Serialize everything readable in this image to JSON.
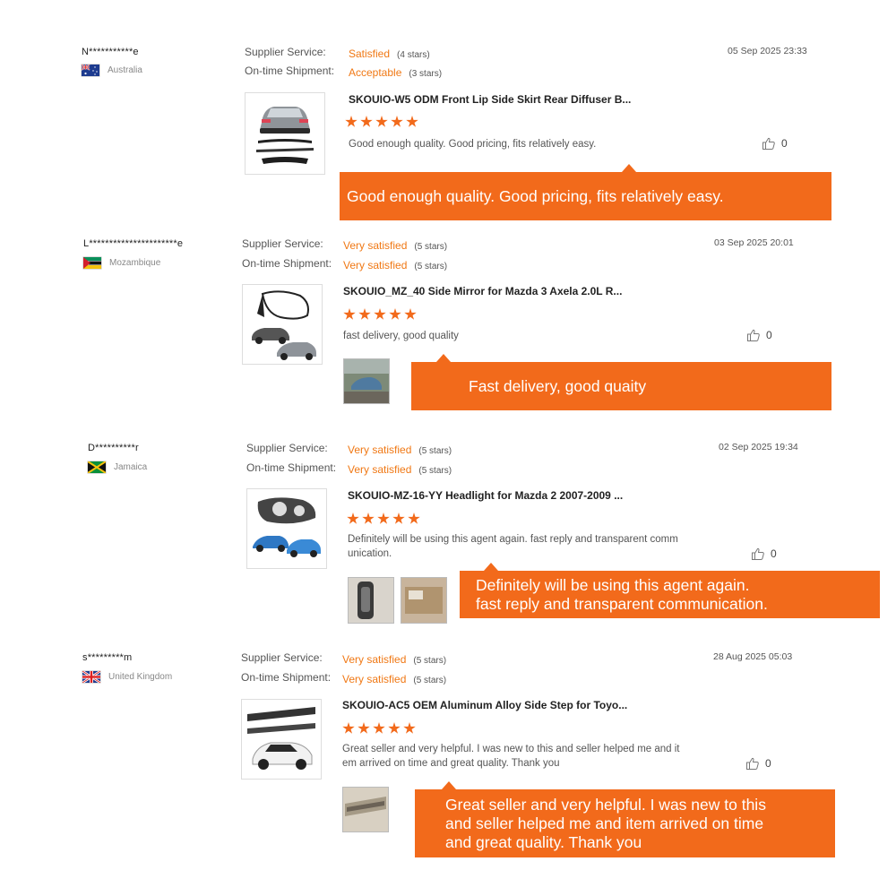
{
  "reviews": [
    {
      "buyer": "N***********e",
      "country": "Australia",
      "supplier_service_label": "Supplier Service:",
      "supplier_service_value": "Satisfied",
      "supplier_service_stars": "(4 stars)",
      "shipment_label": "On-time Shipment:",
      "shipment_value": "Acceptable",
      "shipment_stars": "(3 stars)",
      "date": "05 Sep 2025 23:33",
      "product_title": "SKOUIO-W5 ODM Front Lip Side Skirt Rear Diffuser B...",
      "rating": 5,
      "comment": "Good enough quality. Good pricing, fits relatively easy.",
      "likes": "0",
      "callout": "Good enough quality. Good pricing, fits relatively easy."
    },
    {
      "buyer": "L**********************e",
      "country": "Mozambique",
      "supplier_service_label": "Supplier Service:",
      "supplier_service_value": "Very satisfied",
      "supplier_service_stars": "(5 stars)",
      "shipment_label": "On-time Shipment:",
      "shipment_value": "Very satisfied",
      "shipment_stars": "(5 stars)",
      "date": "03 Sep 2025 20:01",
      "product_title": "SKOUIO_MZ_40 Side Mirror for Mazda 3 Axela 2.0L R...",
      "rating": 5,
      "comment": "fast delivery, good quality",
      "likes": "0",
      "callout": "Fast delivery, good quaity"
    },
    {
      "buyer": "D**********r",
      "country": "Jamaica",
      "supplier_service_label": "Supplier Service:",
      "supplier_service_value": "Very satisfied",
      "supplier_service_stars": "(5 stars)",
      "shipment_label": "On-time Shipment:",
      "shipment_value": "Very satisfied",
      "shipment_stars": "(5 stars)",
      "date": "02 Sep 2025 19:34",
      "product_title": "SKOUIO-MZ-16-YY Headlight for Mazda 2 2007-2009 ...",
      "rating": 5,
      "comment_line1": "Definitely will be using this agent again. fast reply and transparent comm",
      "comment_line2": "unication.",
      "likes": "0",
      "callout_line1": "Definitely will be using this agent again.",
      "callout_line2": "fast reply and transparent communication."
    },
    {
      "buyer": "s*********m",
      "country": "United Kingdom",
      "supplier_service_label": "Supplier Service:",
      "supplier_service_value": "Very satisfied",
      "supplier_service_stars": "(5 stars)",
      "shipment_label": "On-time Shipment:",
      "shipment_value": "Very satisfied",
      "shipment_stars": "(5 stars)",
      "date": "28 Aug 2025 05:03",
      "product_title": "SKOUIO-AC5 OEM Aluminum Alloy Side Step for Toyo...",
      "rating": 5,
      "comment_line1": "Great seller and very helpful. I was new to this and seller helped me and it",
      "comment_line2": "em arrived on time and great quality. Thank you",
      "likes": "0",
      "callout_line1": "Great seller and very helpful. I was new to this",
      "callout_line2": "and seller helped me and item arrived on time",
      "callout_line3": "and great quality. Thank you"
    }
  ],
  "icons": {
    "like": "thumbs-up-icon",
    "star": "star-icon"
  },
  "colors": {
    "accent": "#f26a1b",
    "rating_text": "#f07814"
  }
}
